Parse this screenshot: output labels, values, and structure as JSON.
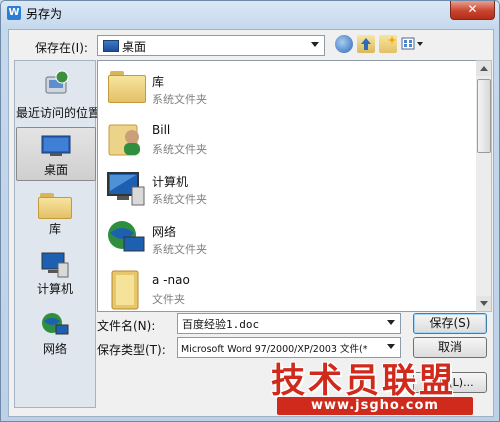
{
  "window": {
    "title": "另存为",
    "app_badge": "W",
    "close_glyph": "✕"
  },
  "toolbar": {
    "save_in_label": "保存在(I):",
    "save_in_value": "桌面",
    "icons": [
      "back-icon",
      "up-folder-icon",
      "new-folder-icon",
      "views-menu-icon"
    ]
  },
  "places": [
    {
      "id": "recent",
      "label": "最近访问的位置",
      "icon": "recent-places-icon",
      "selected": false
    },
    {
      "id": "desktop",
      "label": "桌面",
      "icon": "desktop-icon",
      "selected": true
    },
    {
      "id": "library",
      "label": "库",
      "icon": "library-icon",
      "selected": false
    },
    {
      "id": "computer",
      "label": "计算机",
      "icon": "computer-icon",
      "selected": false
    },
    {
      "id": "network",
      "label": "网络",
      "icon": "network-icon",
      "selected": false
    }
  ],
  "files": [
    {
      "name": "库",
      "type": "系统文件夹",
      "icon": "library-folder-icon"
    },
    {
      "name": "Bill",
      "type": "系统文件夹",
      "icon": "user-folder-icon"
    },
    {
      "name": "计算机",
      "type": "系统文件夹",
      "icon": "computer-icon"
    },
    {
      "name": "网络",
      "type": "系统文件夹",
      "icon": "network-icon"
    },
    {
      "name": "a -nao",
      "type": "文件夹",
      "icon": "folder-icon"
    }
  ],
  "form": {
    "filename_label": "文件名(N):",
    "filename_value": "百度经验1.doc",
    "filetype_label": "保存类型(T):",
    "filetype_value": "Microsoft Word 97/2000/XP/2003 文件(*"
  },
  "buttons": {
    "save": "保存(S)",
    "cancel": "取消",
    "tools": "工具(L)..."
  },
  "watermark": {
    "title": "技术员联盟",
    "url": "www.jsgho.com"
  },
  "colors": {
    "accent": "#3c7fb1",
    "watermark": "#cf2a1c",
    "close": "#c9442e"
  }
}
